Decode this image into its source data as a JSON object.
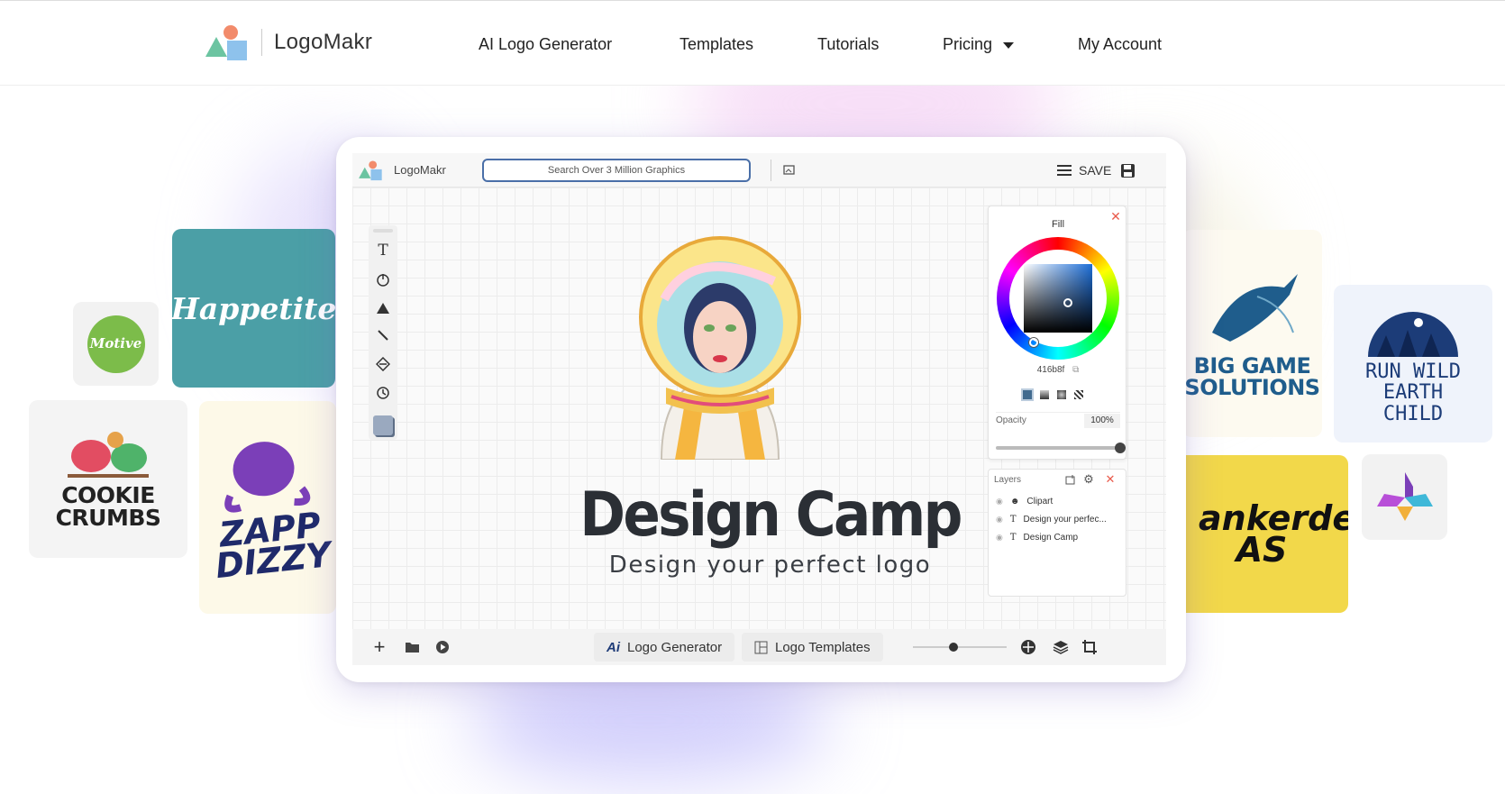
{
  "header": {
    "brand": "LogoMakr",
    "nav": [
      {
        "label": "AI Logo Generator"
      },
      {
        "label": "Templates"
      },
      {
        "label": "Tutorials"
      },
      {
        "label": "Pricing"
      },
      {
        "label": "My Account"
      }
    ]
  },
  "showcase": {
    "cards": [
      {
        "text": "Motive",
        "bg": "#f2f2f2",
        "accent": "#7cbc4a"
      },
      {
        "text": "Happetite",
        "bg": "#4b9fa6",
        "accent": "#ffffff"
      },
      {
        "text": "COOKIE CRUMBS",
        "bg": "#f4f4f4",
        "accent": "#222222"
      },
      {
        "text": "ZAPP DIZZY",
        "bg": "#fdf9e8",
        "accent": "#7b3fb8"
      },
      {
        "text": "BIG GAME SOLUTIONS",
        "bg": "#fdfaf0",
        "accent": "#1f5d8c"
      },
      {
        "text": "RUN WILD EARTH CHILD",
        "bg": "#eff3fb",
        "accent": "#1c3c78"
      },
      {
        "text": "ankerdekk AS",
        "bg": "#f2d84a",
        "accent": "#111111"
      },
      {
        "text": "",
        "bg": "#f2f2f2",
        "accent": "#6d3cc8"
      }
    ]
  },
  "editor": {
    "brand": "LogoMakr",
    "search_placeholder": "Search Over 3 Million Graphics",
    "save_label": "SAVE",
    "canvas": {
      "title": "Design Camp",
      "subtitle": "Design your perfect logo"
    },
    "fill_panel": {
      "title": "Fill",
      "hex": "416b8f",
      "opacity_label": "Opacity",
      "opacity_value": "100%",
      "opacity": 1.0,
      "color": "#416b8f"
    },
    "layers": {
      "title": "Layers",
      "items": [
        {
          "label": "Clipart",
          "icon": "clipart-icon"
        },
        {
          "label": "Design your perfec...",
          "icon": "text-icon"
        },
        {
          "label": "Design Camp",
          "icon": "text-icon"
        }
      ]
    },
    "bottom": {
      "logo_generator_label": "Logo Generator",
      "logo_templates_label": "Logo Templates",
      "ai_badge": "Ai"
    }
  }
}
